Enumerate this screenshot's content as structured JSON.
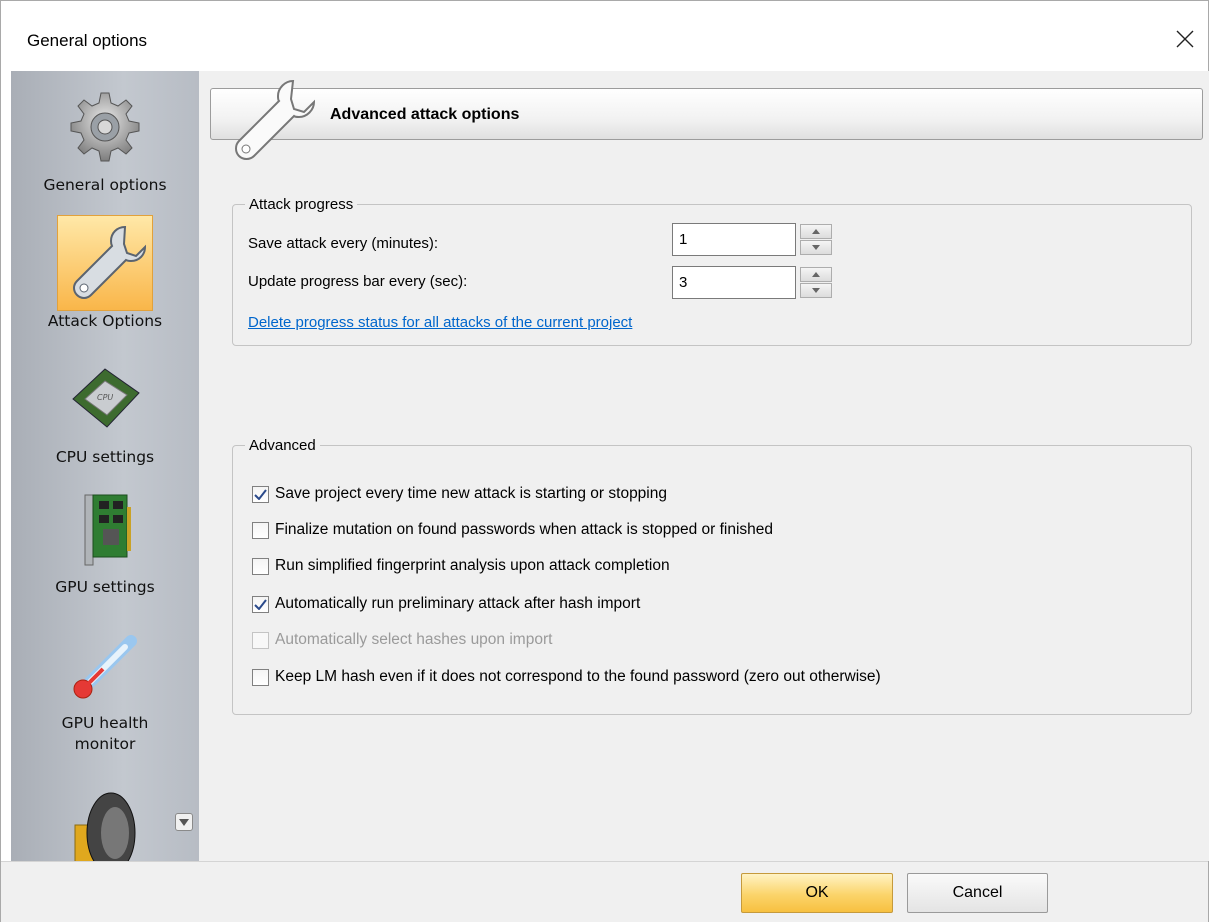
{
  "window": {
    "title": "General options"
  },
  "sidebar": {
    "items": [
      {
        "label": "General options",
        "icon": "gear-icon"
      },
      {
        "label": "Attack Options",
        "icon": "wrench-icon",
        "selected": true
      },
      {
        "label": "CPU settings",
        "icon": "cpu-icon"
      },
      {
        "label": "GPU settings",
        "icon": "gpu-card-icon"
      },
      {
        "label": "GPU health monitor",
        "icon": "thermometer-icon"
      },
      {
        "label": "",
        "icon": "speaker-icon"
      }
    ]
  },
  "main": {
    "header_title": "Advanced attack options",
    "attack_progress": {
      "legend": "Attack progress",
      "save_label": "Save attack every (minutes):",
      "save_value": "1",
      "update_label": "Update progress bar every (sec):",
      "update_value": "3",
      "delete_link": "Delete progress status for all attacks of the current project"
    },
    "advanced": {
      "legend": "Advanced",
      "options": [
        {
          "label": "Save project every time new attack is starting or stopping",
          "checked": true,
          "disabled": false
        },
        {
          "label": "Finalize mutation on found passwords when attack is stopped or finished",
          "checked": false,
          "disabled": false
        },
        {
          "label": "Run simplified fingerprint analysis upon attack completion",
          "checked": false,
          "disabled": false
        },
        {
          "label": "Automatically run preliminary attack after hash import",
          "checked": true,
          "disabled": false
        },
        {
          "label": "Automatically select hashes upon import",
          "checked": false,
          "disabled": true
        },
        {
          "label": "Keep LM hash even if it does not correspond to the found password (zero out otherwise)",
          "checked": false,
          "disabled": false
        }
      ]
    }
  },
  "footer": {
    "ok_label": "OK",
    "cancel_label": "Cancel"
  },
  "colors": {
    "selected_bg": "#f9b64a",
    "link": "#0066cc",
    "ok_button": "#fbd46a"
  }
}
